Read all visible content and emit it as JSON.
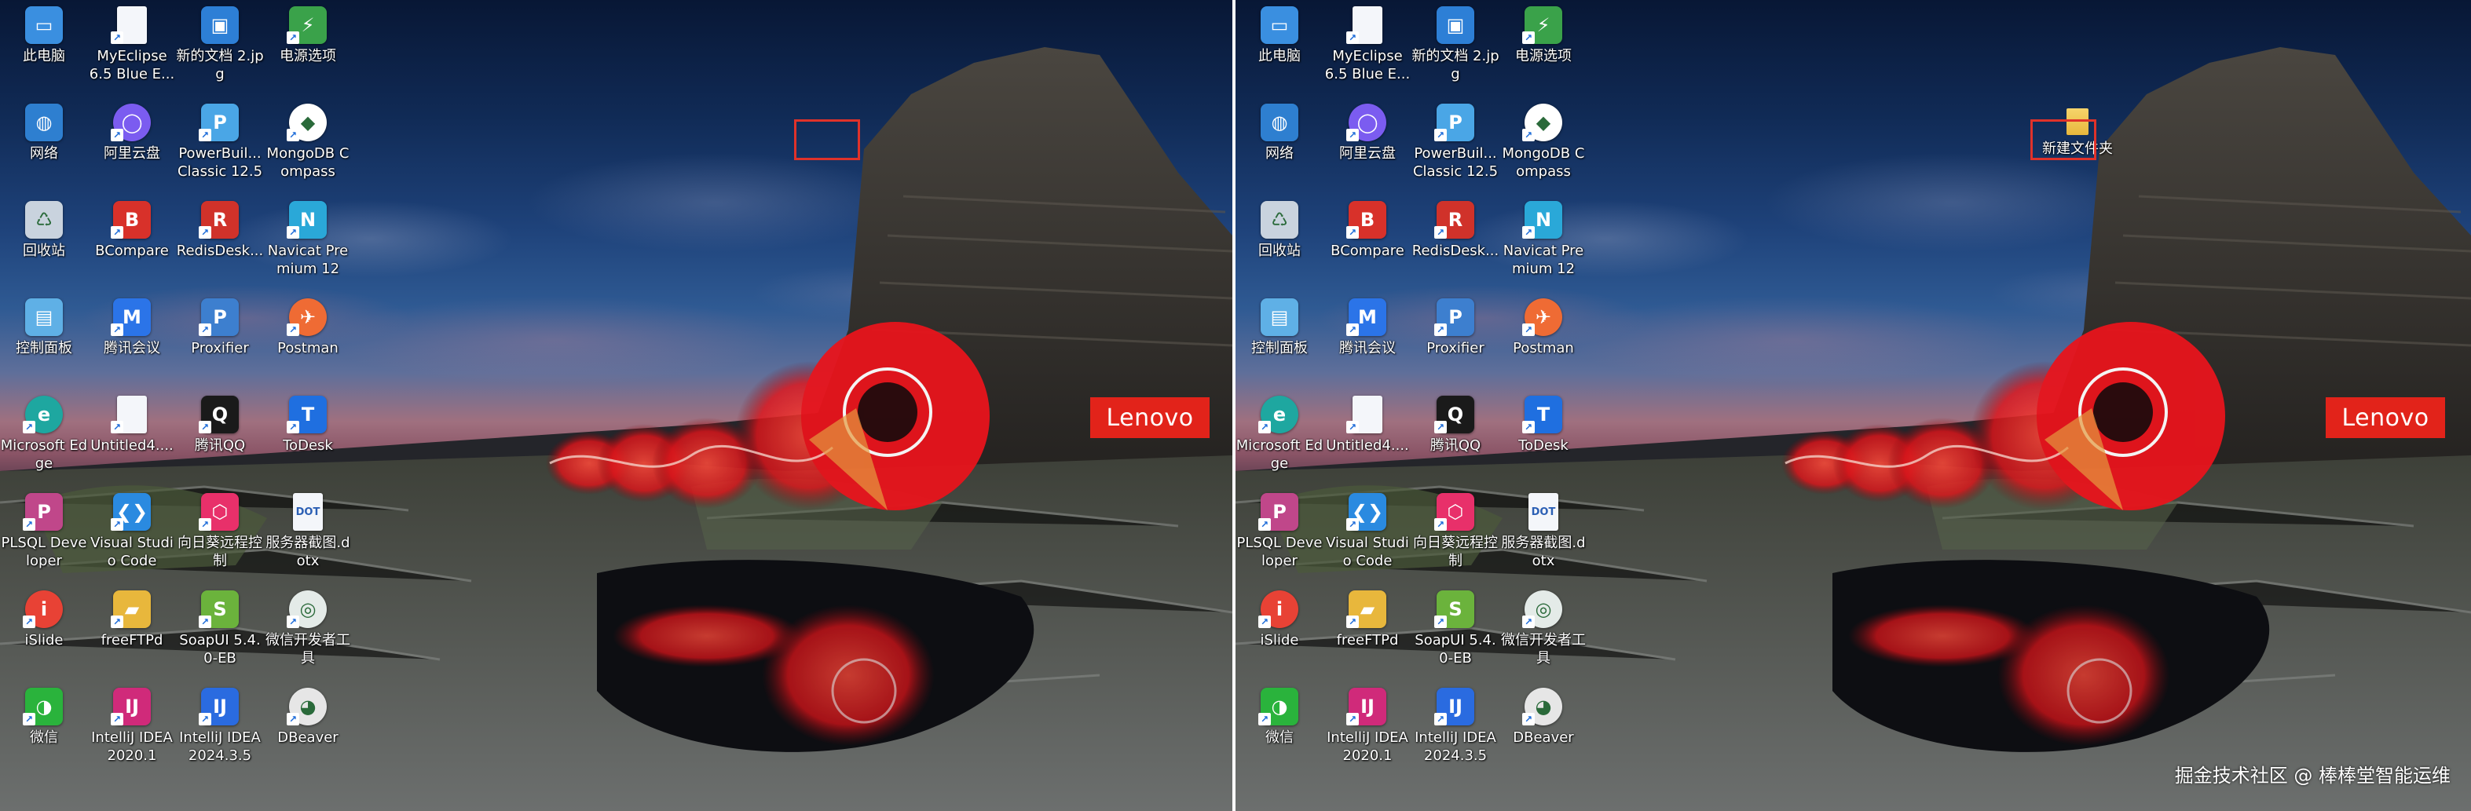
{
  "panels": {
    "left": {
      "icons": [
        {
          "label": "此电脑",
          "icon": "this-pc-icon",
          "glyph": "▭",
          "color": "#3a8fe0",
          "shortcut": false
        },
        {
          "label": "MyEclipse 6.5 Blue E...",
          "icon": "document-icon",
          "glyph": "",
          "color": "#f4f6fa",
          "shortcut": true
        },
        {
          "label": "新的文档 2.jpg",
          "icon": "image-file-icon",
          "glyph": "▣",
          "color": "#2d7fd6",
          "shortcut": false
        },
        {
          "label": "电源选项",
          "icon": "power-options-icon",
          "glyph": "⚡",
          "color": "#3aa24a",
          "shortcut": true
        },
        {
          "label": "网络",
          "icon": "network-icon",
          "glyph": "◍",
          "color": "#2e7fd0",
          "shortcut": false
        },
        {
          "label": "阿里云盘",
          "icon": "aliyun-drive-icon",
          "glyph": "◯",
          "color": "#7b5cf0",
          "shortcut": true
        },
        {
          "label": "PowerBuil... Classic 12.5",
          "icon": "powerbuilder-icon",
          "glyph": "P",
          "color": "#4aa6e6",
          "shortcut": true
        },
        {
          "label": "MongoDB Compass",
          "icon": "mongodb-compass-icon",
          "glyph": "◆",
          "color": "#ffffff",
          "shortcut": true
        },
        {
          "label": "回收站",
          "icon": "recycle-bin-icon",
          "glyph": "♺",
          "color": "#c9d3de",
          "shortcut": false
        },
        {
          "label": "BCompare",
          "icon": "bcompare-icon",
          "glyph": "B",
          "color": "#d8312a",
          "shortcut": true
        },
        {
          "label": "RedisDesk...",
          "icon": "redis-desktop-icon",
          "glyph": "R",
          "color": "#d0322a",
          "shortcut": true
        },
        {
          "label": "Navicat Premium 12",
          "icon": "navicat-icon",
          "glyph": "N",
          "color": "#2aa8d8",
          "shortcut": true
        },
        {
          "label": "控制面板",
          "icon": "control-panel-icon",
          "glyph": "▤",
          "color": "#5fb0e6",
          "shortcut": false
        },
        {
          "label": "腾讯会议",
          "icon": "tencent-meeting-icon",
          "glyph": "M",
          "color": "#2b74e8",
          "shortcut": true
        },
        {
          "label": "Proxifier",
          "icon": "proxifier-icon",
          "glyph": "P",
          "color": "#3d7fcf",
          "shortcut": true
        },
        {
          "label": "Postman",
          "icon": "postman-icon",
          "glyph": "✈",
          "color": "#ef6b34",
          "shortcut": true
        },
        {
          "label": "Microsoft Edge",
          "icon": "edge-icon",
          "glyph": "e",
          "color": "#1ea7a0",
          "shortcut": true
        },
        {
          "label": "Untitled4....",
          "icon": "document-icon",
          "glyph": "",
          "color": "#f4f6fa",
          "shortcut": true
        },
        {
          "label": "腾讯QQ",
          "icon": "qq-icon",
          "glyph": "Q",
          "color": "#1a1a1a",
          "shortcut": true
        },
        {
          "label": "ToDesk",
          "icon": "todesk-icon",
          "glyph": "T",
          "color": "#1f6fe0",
          "shortcut": true
        },
        {
          "label": "PLSQL Developer",
          "icon": "plsql-icon",
          "glyph": "P",
          "color": "#c0478a",
          "shortcut": true
        },
        {
          "label": "Visual Studio Code",
          "icon": "vscode-icon",
          "glyph": "❮❯",
          "color": "#2a8ae0",
          "shortcut": true
        },
        {
          "label": "向日葵远程控制",
          "icon": "sunlogin-icon",
          "glyph": "⬡",
          "color": "#e8306a",
          "shortcut": true
        },
        {
          "label": "服务器截图.dotx",
          "icon": "dotx-file-icon",
          "glyph": "DOT",
          "color": "#f4f6fa",
          "shortcut": false
        },
        {
          "label": "iSlide",
          "icon": "islide-icon",
          "glyph": "i",
          "color": "#e84235",
          "shortcut": true
        },
        {
          "label": "freeFTPd",
          "icon": "folder-shortcut-icon",
          "glyph": "▰",
          "color": "#e8b73c",
          "shortcut": true
        },
        {
          "label": "SoapUI 5.4.0-EB",
          "icon": "soapui-icon",
          "glyph": "S",
          "color": "#6bb33c",
          "shortcut": true
        },
        {
          "label": "微信开发者工具",
          "icon": "wechat-devtools-icon",
          "glyph": "◎",
          "color": "#e4ebe8",
          "shortcut": true
        },
        {
          "label": "微信",
          "icon": "wechat-icon",
          "glyph": "◑",
          "color": "#2ab33c",
          "shortcut": true
        },
        {
          "label": "IntelliJ IDEA 2020.1",
          "icon": "intellij-idea-icon",
          "glyph": "IJ",
          "color": "#d02a7a",
          "shortcut": true
        },
        {
          "label": "IntelliJ IDEA 2024.3.5",
          "icon": "intellij-idea-icon",
          "glyph": "IJ",
          "color": "#2a6be0",
          "shortcut": true
        },
        {
          "label": "DBeaver",
          "icon": "dbeaver-icon",
          "glyph": "◕",
          "color": "#e6e6e6",
          "shortcut": true
        }
      ],
      "lenovo_logo": "Lenovo"
    },
    "right": {
      "new_folder_label": "新建文件夹",
      "lenovo_logo": "Lenovo",
      "watermark": "掘金技术社区 @ 棒棒堂智能运维"
    }
  },
  "colors": {
    "selection": "#e0322a",
    "lenovo_red": "#e2231a",
    "label_text": "#ffffff"
  }
}
